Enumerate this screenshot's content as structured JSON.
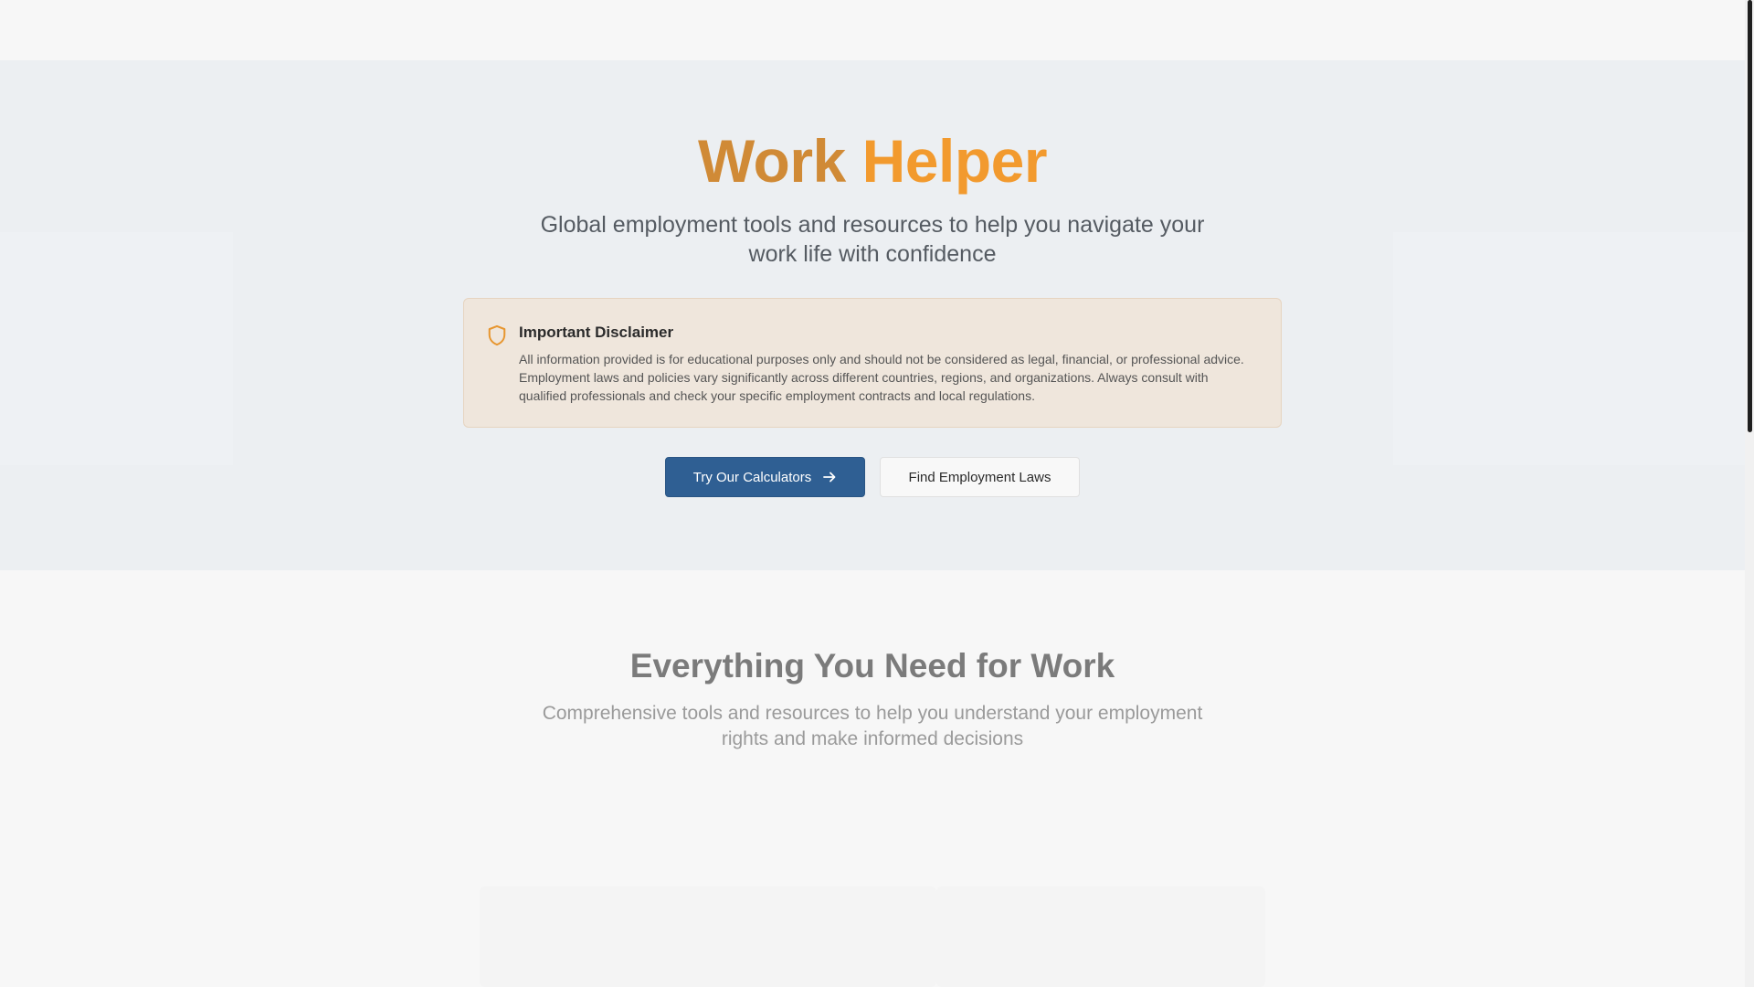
{
  "hero": {
    "title_word1": "Work",
    "title_word2": "Helper",
    "subtitle": "Global employment tools and resources to help you navigate your work life with confidence",
    "disclaimer": {
      "icon": "shield-icon",
      "title": "Important Disclaimer",
      "body": "All information provided is for educational purposes only and should not be considered as legal, financial, or professional advice. Employment laws and policies vary significantly across different countries, regions, and organizations. Always consult with qualified professionals and check your specific employment contracts and local regulations."
    },
    "primary_button": {
      "label": "Try Our Calculators",
      "icon": "arrow-right-icon"
    },
    "secondary_button": {
      "label": "Find Employment Laws"
    }
  },
  "features": {
    "title": "Everything You Need for Work",
    "subtitle": "Comprehensive tools and resources to help you understand your employment rights and make informed decisions"
  },
  "colors": {
    "accent_orange": "#f29a2e",
    "accent_orange_dark": "#d08a36",
    "primary_blue": "#2f5f93",
    "hero_bg": "#eceff2",
    "disclaimer_bg": "#efe6dc"
  }
}
